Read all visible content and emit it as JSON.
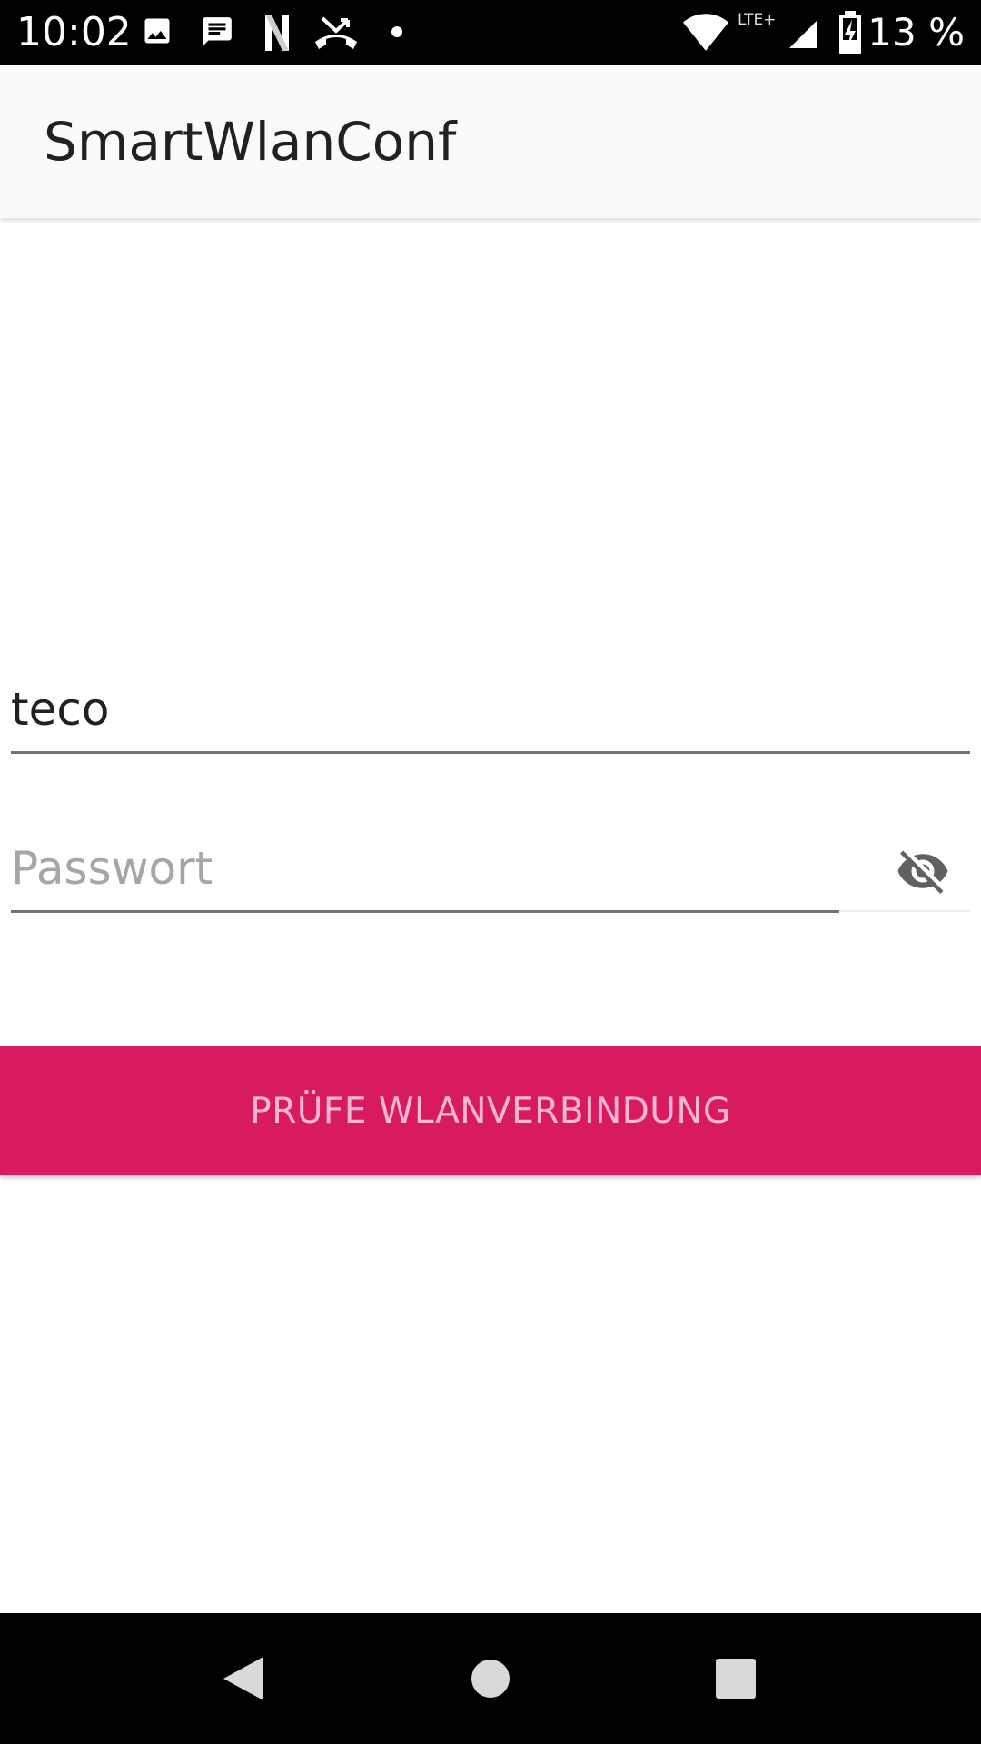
{
  "status_bar": {
    "time": "10:02",
    "network_label": "LTE+",
    "battery_percent": "13 %",
    "notification_icons": [
      "image-icon",
      "message-icon",
      "netflix-icon",
      "missed-call-icon",
      "dot-icon"
    ],
    "system_icons": [
      "wifi-icon",
      "signal-icon",
      "battery-charging-icon"
    ]
  },
  "app_bar": {
    "title": "SmartWlanConf"
  },
  "form": {
    "ssid_value": "teco",
    "password_placeholder": "Passwort",
    "password_toggle_icon": "eye-off-icon",
    "check_button_label": "PRÜFE WLANVERBINDUNG"
  },
  "nav_bar": {
    "buttons": [
      "back-icon",
      "home-icon",
      "recents-icon"
    ]
  },
  "colors": {
    "accent": "#d81b60",
    "button_text": "#f7b8cf",
    "app_bar_bg": "#fafafa",
    "status_bar_bg": "#000000"
  }
}
